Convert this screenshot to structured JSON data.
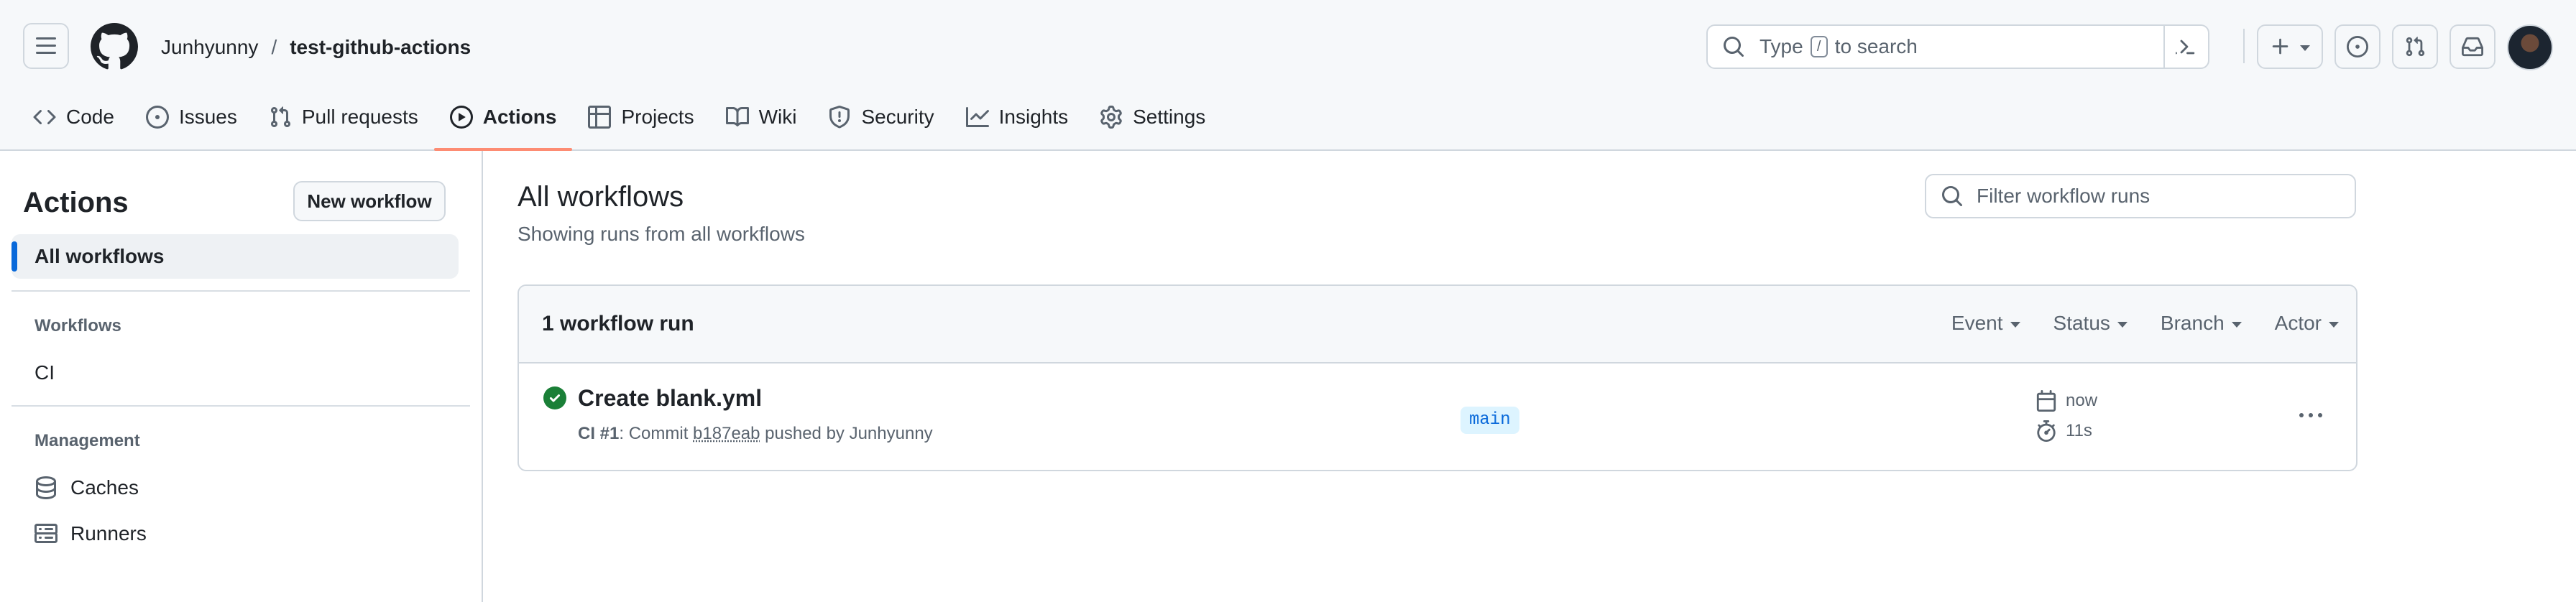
{
  "header": {
    "owner": "Junhyunny",
    "separator": "/",
    "repo": "test-github-actions",
    "search_pre": "Type",
    "search_key": "/",
    "search_post": "to search"
  },
  "repo_nav": {
    "tabs": [
      {
        "label": "Code",
        "icon": "code-icon"
      },
      {
        "label": "Issues",
        "icon": "issue-icon"
      },
      {
        "label": "Pull requests",
        "icon": "pull-request-icon"
      },
      {
        "label": "Actions",
        "icon": "play-icon",
        "active": true
      },
      {
        "label": "Projects",
        "icon": "table-icon"
      },
      {
        "label": "Wiki",
        "icon": "book-icon"
      },
      {
        "label": "Security",
        "icon": "shield-icon"
      },
      {
        "label": "Insights",
        "icon": "graph-icon"
      },
      {
        "label": "Settings",
        "icon": "gear-icon"
      }
    ]
  },
  "sidebar": {
    "title": "Actions",
    "new_workflow": "New workflow",
    "all_workflows": "All workflows",
    "workflows_heading": "Workflows",
    "workflows": [
      "CI"
    ],
    "management_heading": "Management",
    "caches": "Caches",
    "runners": "Runners"
  },
  "main": {
    "title": "All workflows",
    "subtitle": "Showing runs from all workflows",
    "filter_placeholder": "Filter workflow runs",
    "run_count": "1 workflow run",
    "filters": {
      "event": "Event",
      "status": "Status",
      "branch": "Branch",
      "actor": "Actor"
    },
    "runs": [
      {
        "title": "Create blank.yml",
        "workflow": "CI #1",
        "meta_prefix": ": Commit",
        "sha": "b187eab",
        "meta_suffix": "pushed by Junhyunny",
        "branch": "main",
        "when": "now",
        "duration": "11s",
        "status": "success"
      }
    ]
  },
  "colors": {
    "accent_underline": "#fd8c73",
    "selected_bar": "#0969da",
    "success": "#1a7f37",
    "branch_bg": "#ddf4ff",
    "branch_fg": "#0969da"
  }
}
